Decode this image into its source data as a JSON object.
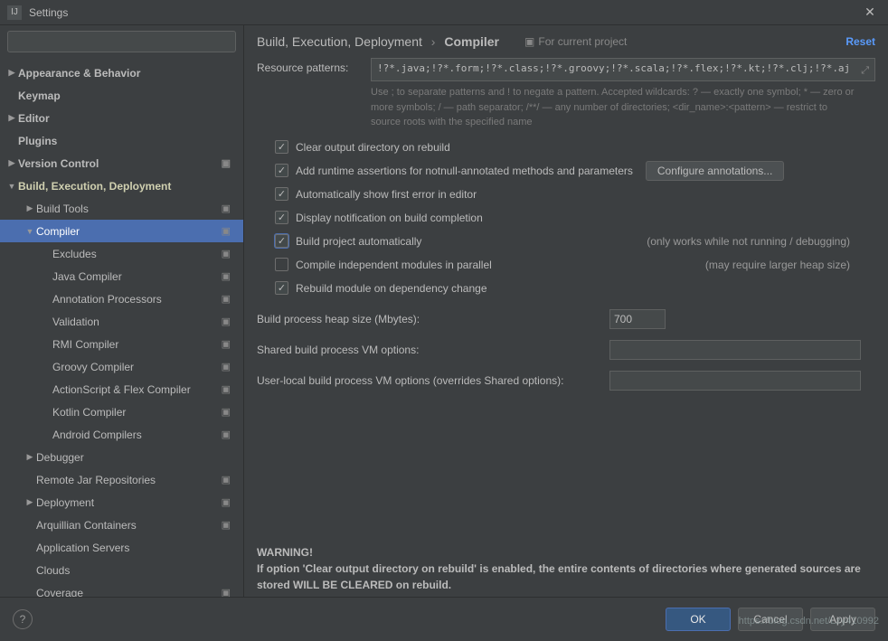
{
  "window": {
    "title": "Settings"
  },
  "search": {
    "placeholder": ""
  },
  "sidebar": {
    "items": [
      {
        "label": "Appearance & Behavior",
        "indent": 0,
        "arrow": "▶",
        "bold": true
      },
      {
        "label": "Keymap",
        "indent": 0,
        "arrow": "",
        "bold": true
      },
      {
        "label": "Editor",
        "indent": 0,
        "arrow": "▶",
        "bold": true
      },
      {
        "label": "Plugins",
        "indent": 0,
        "arrow": "",
        "bold": true
      },
      {
        "label": "Version Control",
        "indent": 0,
        "arrow": "▶",
        "bold": true,
        "project": true
      },
      {
        "label": "Build, Execution, Deployment",
        "indent": 0,
        "arrow": "▼",
        "bold": true,
        "yellow": true
      },
      {
        "label": "Build Tools",
        "indent": 1,
        "arrow": "▶",
        "project": true
      },
      {
        "label": "Compiler",
        "indent": 1,
        "arrow": "▼",
        "selected": true,
        "project": true
      },
      {
        "label": "Excludes",
        "indent": 2,
        "project": true
      },
      {
        "label": "Java Compiler",
        "indent": 2,
        "project": true
      },
      {
        "label": "Annotation Processors",
        "indent": 2,
        "project": true
      },
      {
        "label": "Validation",
        "indent": 2,
        "project": true
      },
      {
        "label": "RMI Compiler",
        "indent": 2,
        "project": true
      },
      {
        "label": "Groovy Compiler",
        "indent": 2,
        "project": true
      },
      {
        "label": "ActionScript & Flex Compiler",
        "indent": 2,
        "project": true
      },
      {
        "label": "Kotlin Compiler",
        "indent": 2,
        "project": true
      },
      {
        "label": "Android Compilers",
        "indent": 2,
        "project": true
      },
      {
        "label": "Debugger",
        "indent": 1,
        "arrow": "▶"
      },
      {
        "label": "Remote Jar Repositories",
        "indent": 1,
        "project": true
      },
      {
        "label": "Deployment",
        "indent": 1,
        "arrow": "▶",
        "project": true
      },
      {
        "label": "Arquillian Containers",
        "indent": 1,
        "project": true
      },
      {
        "label": "Application Servers",
        "indent": 1
      },
      {
        "label": "Clouds",
        "indent": 1
      },
      {
        "label": "Coverage",
        "indent": 1,
        "project": true
      }
    ]
  },
  "breadcrumb": {
    "parent": "Build, Execution, Deployment",
    "current": "Compiler"
  },
  "for_project": "For current project",
  "reset": "Reset",
  "resource_patterns": {
    "label": "Resource patterns:",
    "value": "!?*.java;!?*.form;!?*.class;!?*.groovy;!?*.scala;!?*.flex;!?*.kt;!?*.clj;!?*.aj",
    "hint": "Use ; to separate patterns and ! to negate a pattern. Accepted wildcards: ? — exactly one symbol; * — zero or more symbols; / — path separator; /**/ — any number of directories; <dir_name>:<pattern> — restrict to source roots with the specified name"
  },
  "checks": {
    "clear_output": {
      "label": "Clear output directory on rebuild",
      "checked": true
    },
    "add_assertions": {
      "label": "Add runtime assertions for notnull-annotated methods and parameters",
      "checked": true,
      "button": "Configure annotations..."
    },
    "auto_show_error": {
      "label": "Automatically show first error in editor",
      "checked": true
    },
    "display_notification": {
      "label": "Display notification on build completion",
      "checked": true
    },
    "build_auto": {
      "label": "Build project automatically",
      "checked": true,
      "highlight": true,
      "note": "(only works while not running / debugging)"
    },
    "compile_parallel": {
      "label": "Compile independent modules in parallel",
      "checked": false,
      "note": "(may require larger heap size)"
    },
    "rebuild_dep": {
      "label": "Rebuild module on dependency change",
      "checked": true
    }
  },
  "heap": {
    "label": "Build process heap size (Mbytes):",
    "value": "700"
  },
  "shared_vm": {
    "label": "Shared build process VM options:",
    "value": ""
  },
  "user_vm": {
    "label": "User-local build process VM options (overrides Shared options):",
    "value": ""
  },
  "warning": {
    "title": "WARNING!",
    "body": "If option 'Clear output directory on rebuild' is enabled, the entire contents of directories where generated sources are stored WILL BE CLEARED on rebuild."
  },
  "footer": {
    "ok": "OK",
    "cancel": "Cancel",
    "apply": "Apply"
  },
  "watermark": "https://blog.csdn.net/Lzy410992"
}
